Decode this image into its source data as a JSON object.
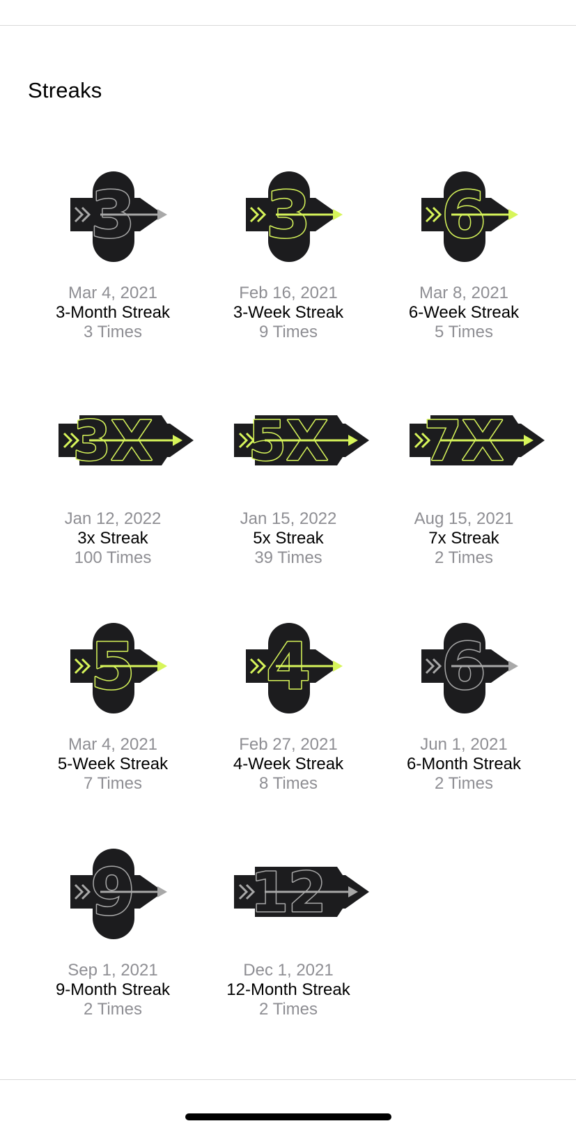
{
  "section": {
    "title": "Streaks"
  },
  "colors": {
    "badge_dark": "#1c1c1e",
    "accent_volt": "#d7f55a",
    "locked_grey": "#a8a8a8"
  },
  "badges": [
    {
      "number": "3",
      "style": "grey",
      "icon": "streak-3-badge-icon",
      "date": "Mar 4, 2021",
      "name": "3-Month Streak",
      "count": "3 Times"
    },
    {
      "number": "3",
      "style": "volt",
      "icon": "streak-3-badge-icon",
      "date": "Feb 16, 2021",
      "name": "3-Week Streak",
      "count": "9 Times"
    },
    {
      "number": "6",
      "style": "volt",
      "icon": "streak-6-badge-icon",
      "date": "Mar 8, 2021",
      "name": "6-Week Streak",
      "count": "5 Times"
    },
    {
      "number": "3X",
      "style": "volt",
      "icon": "streak-3x-badge-icon",
      "date": "Jan 12, 2022",
      "name": "3x Streak",
      "count": "100 Times"
    },
    {
      "number": "5X",
      "style": "volt",
      "icon": "streak-5x-badge-icon",
      "date": "Jan 15, 2022",
      "name": "5x Streak",
      "count": "39 Times"
    },
    {
      "number": "7X",
      "style": "volt",
      "icon": "streak-7x-badge-icon",
      "date": "Aug 15, 2021",
      "name": "7x Streak",
      "count": "2 Times"
    },
    {
      "number": "5",
      "style": "volt",
      "icon": "streak-5-badge-icon",
      "date": "Mar 4, 2021",
      "name": "5-Week Streak",
      "count": "7 Times"
    },
    {
      "number": "4",
      "style": "volt",
      "icon": "streak-4-badge-icon",
      "date": "Feb 27, 2021",
      "name": "4-Week Streak",
      "count": "8 Times"
    },
    {
      "number": "6",
      "style": "grey",
      "icon": "streak-6-badge-icon",
      "date": "Jun 1, 2021",
      "name": "6-Month Streak",
      "count": "2 Times"
    },
    {
      "number": "9",
      "style": "grey",
      "icon": "streak-9-badge-icon",
      "date": "Sep 1, 2021",
      "name": "9-Month Streak",
      "count": "2 Times"
    },
    {
      "number": "12",
      "style": "grey",
      "icon": "streak-12-badge-icon",
      "date": "Dec 1, 2021",
      "name": "12-Month Streak",
      "count": "2 Times"
    }
  ]
}
